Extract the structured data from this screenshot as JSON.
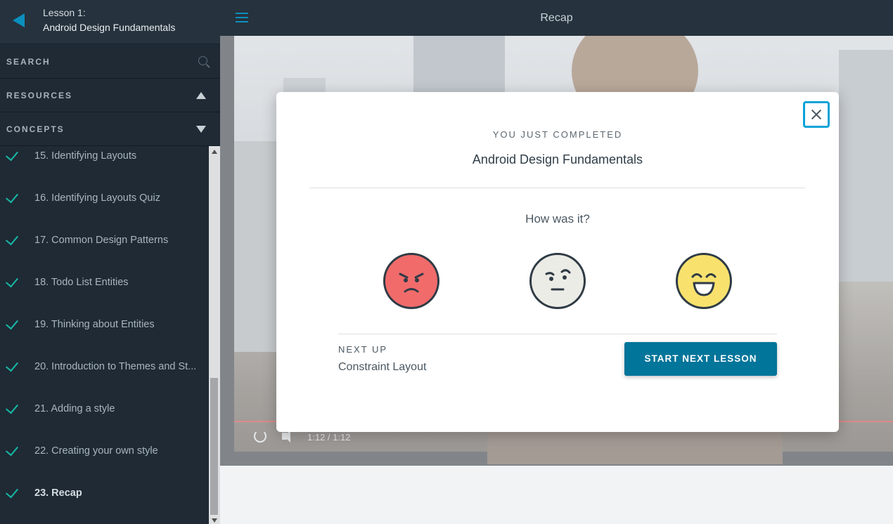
{
  "sidebar": {
    "lesson_label": "Lesson 1:",
    "lesson_title": "Android Design Fundamentals",
    "search_label": "SEARCH",
    "resources_label": "RESOURCES",
    "concepts_label": "CONCEPTS",
    "concepts": [
      {
        "label": "15. Identifying Layouts",
        "completed": true
      },
      {
        "label": "16. Identifying Layouts Quiz",
        "completed": true
      },
      {
        "label": "17. Common Design Patterns",
        "completed": true
      },
      {
        "label": "18. Todo List Entities",
        "completed": true
      },
      {
        "label": "19. Thinking about Entities",
        "completed": true
      },
      {
        "label": "20. Introduction to Themes and St...",
        "completed": true
      },
      {
        "label": "21. Adding a style",
        "completed": true
      },
      {
        "label": "22. Creating your own style",
        "completed": true
      },
      {
        "label": "23. Recap",
        "completed": true,
        "active": true
      }
    ]
  },
  "header": {
    "title": "Recap"
  },
  "video": {
    "time": "1:12 / 1:12"
  },
  "modal": {
    "completed_label": "YOU JUST COMPLETED",
    "completed_title": "Android Design Fundamentals",
    "how_label": "How was it?",
    "ratings": [
      "angry-face-icon",
      "neutral-face-icon",
      "happy-face-icon"
    ],
    "next_label": "NEXT UP",
    "next_title": "Constraint Layout",
    "start_button": "START NEXT LESSON"
  },
  "colors": {
    "accent": "#02759a",
    "check": "#17b8a6",
    "focus_ring": "#08a3d8"
  }
}
